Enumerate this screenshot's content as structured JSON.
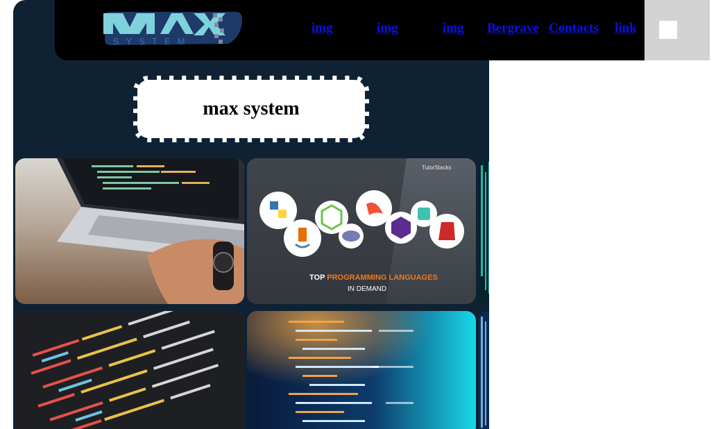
{
  "brand": {
    "logo_text_top": "MAX",
    "logo_text_bottom": "SYSTEM"
  },
  "nav": {
    "links": [
      {
        "label": "img"
      },
      {
        "label": "img"
      },
      {
        "label": "img"
      },
      {
        "label": "Bergrave"
      },
      {
        "label": "Contacts"
      },
      {
        "label": "link"
      }
    ]
  },
  "hero": {
    "title": "max system"
  },
  "gallery": {
    "tiles": [
      {
        "name": "laptop-coding-photo"
      },
      {
        "name": "programming-languages-photo",
        "caption_line1_prefix": "TOP ",
        "caption_line1_highlight": "PROGRAMMING LANGUAGES",
        "caption_line2": "IN DEMAND",
        "brand_mark": "TutorStacks"
      },
      {
        "name": "binary-code-photo"
      },
      {
        "name": "code-screen-photo"
      },
      {
        "name": "code-blue-glow-photo"
      },
      {
        "name": "code-glow-edge-photo"
      }
    ]
  },
  "colors": {
    "panel": "#0f2233",
    "navbar": "#000000",
    "link": "#0b10e6",
    "toggle_area": "#d3d3d3",
    "orange_highlight": "#f07a1a"
  }
}
